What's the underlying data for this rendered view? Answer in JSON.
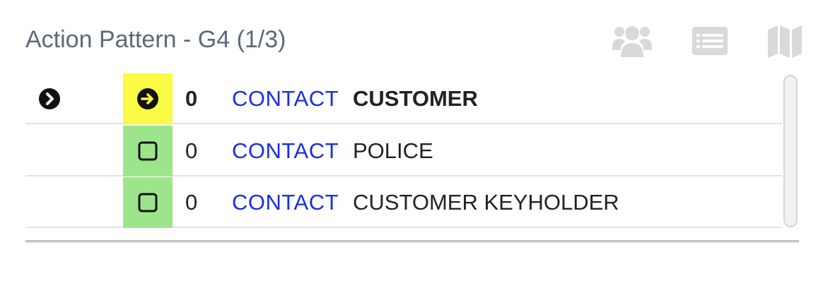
{
  "panel": {
    "title": "Action Pattern - G4 (1/3)",
    "header_icons": [
      "users-icon",
      "list-card-icon",
      "map-icon"
    ],
    "icon_color": "#d9d9d9"
  },
  "rows": [
    {
      "current": true,
      "status": "current",
      "status_color": "#fbfb45",
      "count": "0",
      "action": "CONTACT",
      "target": "CUSTOMER"
    },
    {
      "current": false,
      "status": "pending",
      "status_color": "#9de58a",
      "count": "0",
      "action": "CONTACT",
      "target": "POLICE"
    },
    {
      "current": false,
      "status": "pending",
      "status_color": "#9de58a",
      "count": "0",
      "action": "CONTACT",
      "target": "CUSTOMER KEYHOLDER"
    }
  ],
  "colors": {
    "title": "#5a6a78",
    "action_link": "#1a2ee6"
  }
}
